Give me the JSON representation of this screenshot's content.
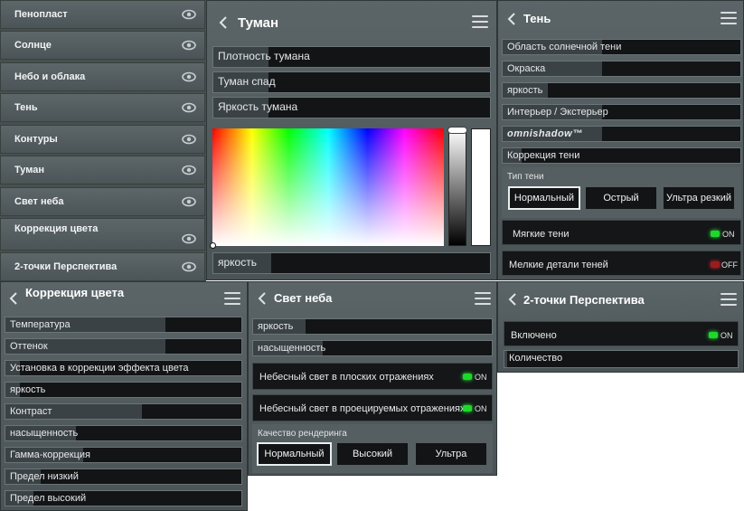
{
  "sidebar": {
    "items": [
      {
        "label": "Пенопласт"
      },
      {
        "label": "Солнце"
      },
      {
        "label": "Небо и облака"
      },
      {
        "label": "Тень"
      },
      {
        "label": "Контуры"
      },
      {
        "label": "Туман"
      },
      {
        "label": "Свет неба"
      },
      {
        "label": "Коррекция цвета"
      },
      {
        "label": "2-точки Перспектива"
      }
    ],
    "icon": "eye-icon"
  },
  "fog": {
    "title": "Туман",
    "sliders": [
      {
        "label": "Плотность тумана",
        "value": 0.3
      },
      {
        "label": "Туман спад",
        "value": 0.3
      },
      {
        "label": "Яркость тумана",
        "value": 0.3
      }
    ],
    "brightness_label": "яркость",
    "brightness_value": 0.22
  },
  "shadow": {
    "title": "Тень",
    "sliders": [
      {
        "label": "Область солнечной тени",
        "value": 0.42
      },
      {
        "label": "Окраска",
        "value": 0.42
      },
      {
        "label": "яркость",
        "value": 0.19
      },
      {
        "label": "Интерьер / Экстерьер",
        "value": 0.42
      },
      {
        "label": "omnishadow™",
        "value": 0.42
      },
      {
        "label": "Коррекция тени",
        "value": 0.08
      }
    ],
    "type_label": "Тип тени",
    "types": [
      "Нормальный",
      "Острый",
      "Ультра резкий"
    ],
    "soft_label": "Мягкие тени",
    "soft_state": "ON",
    "fine_label": "Мелкие детали теней",
    "fine_state": "OFF"
  },
  "color": {
    "title": "Коррекция цвета",
    "sliders": [
      {
        "label": "Температура",
        "value": 0.68
      },
      {
        "label": "Оттенок",
        "value": 0.68
      },
      {
        "label": "Установка в коррекции эффекта цвета",
        "value": 0.06
      },
      {
        "label": "яркость",
        "value": 0.06
      },
      {
        "label": "Контраст",
        "value": 0.58
      },
      {
        "label": "насыщенность",
        "value": 0.3
      },
      {
        "label": "Гамма-коррекция",
        "value": 0.33
      },
      {
        "label": "Предел низкий",
        "value": 0.15
      },
      {
        "label": "Предел высокий",
        "value": 0.12
      }
    ]
  },
  "sky": {
    "title": "Свет неба",
    "sliders": [
      {
        "label": "яркость",
        "value": 0.22
      },
      {
        "label": "насыщенность",
        "value": 0.29
      }
    ],
    "flat_label": "Небесный свет в плоских отражениях",
    "flat_state": "ON",
    "proj_label": "Небесный свет в проецируемых отражениях",
    "proj_state": "ON",
    "quality_label": "Качество рендеринга",
    "qualities": [
      "Нормальный",
      "Высокий",
      "Ультра"
    ]
  },
  "persp": {
    "title": "2-точки Перспектива",
    "enabled_label": "Включено",
    "enabled_state": "ON",
    "count_label": "Количество",
    "count_value": 0.0
  }
}
